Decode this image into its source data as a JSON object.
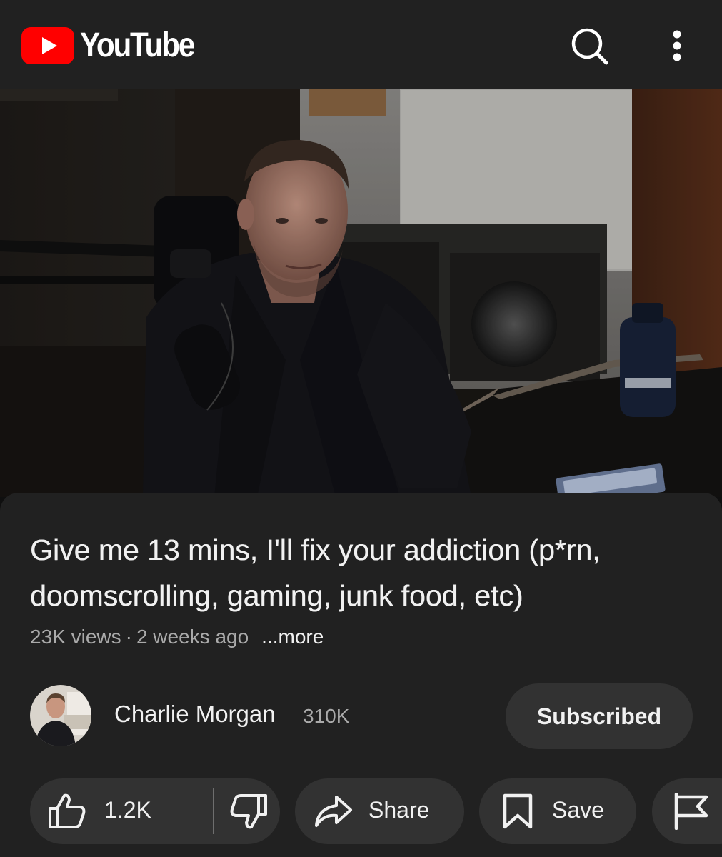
{
  "app": {
    "name": "YouTube",
    "brand_color": "#FF0000",
    "header_background": "#212121",
    "icons": [
      "play-logo-icon",
      "search-icon",
      "more-vert-icon"
    ]
  },
  "video": {
    "title": "Give me 13 mins, I'll fix your addiction (p*rn, doomscrolling, gaming, junk food, etc)",
    "views": "23K views",
    "separator": "·",
    "uploaded": "2 weeks ago",
    "more_label": "...more"
  },
  "channel": {
    "name": "Charlie Morgan",
    "subscribers": "310K",
    "subscribe_label": "Subscribed"
  },
  "actions": {
    "likes": "1.2K",
    "share_label": "Share",
    "save_label": "Save",
    "icons": [
      "thumbs-up-icon",
      "thumbs-down-icon",
      "share-arrow-icon",
      "bookmark-icon",
      "flag-icon"
    ]
  }
}
